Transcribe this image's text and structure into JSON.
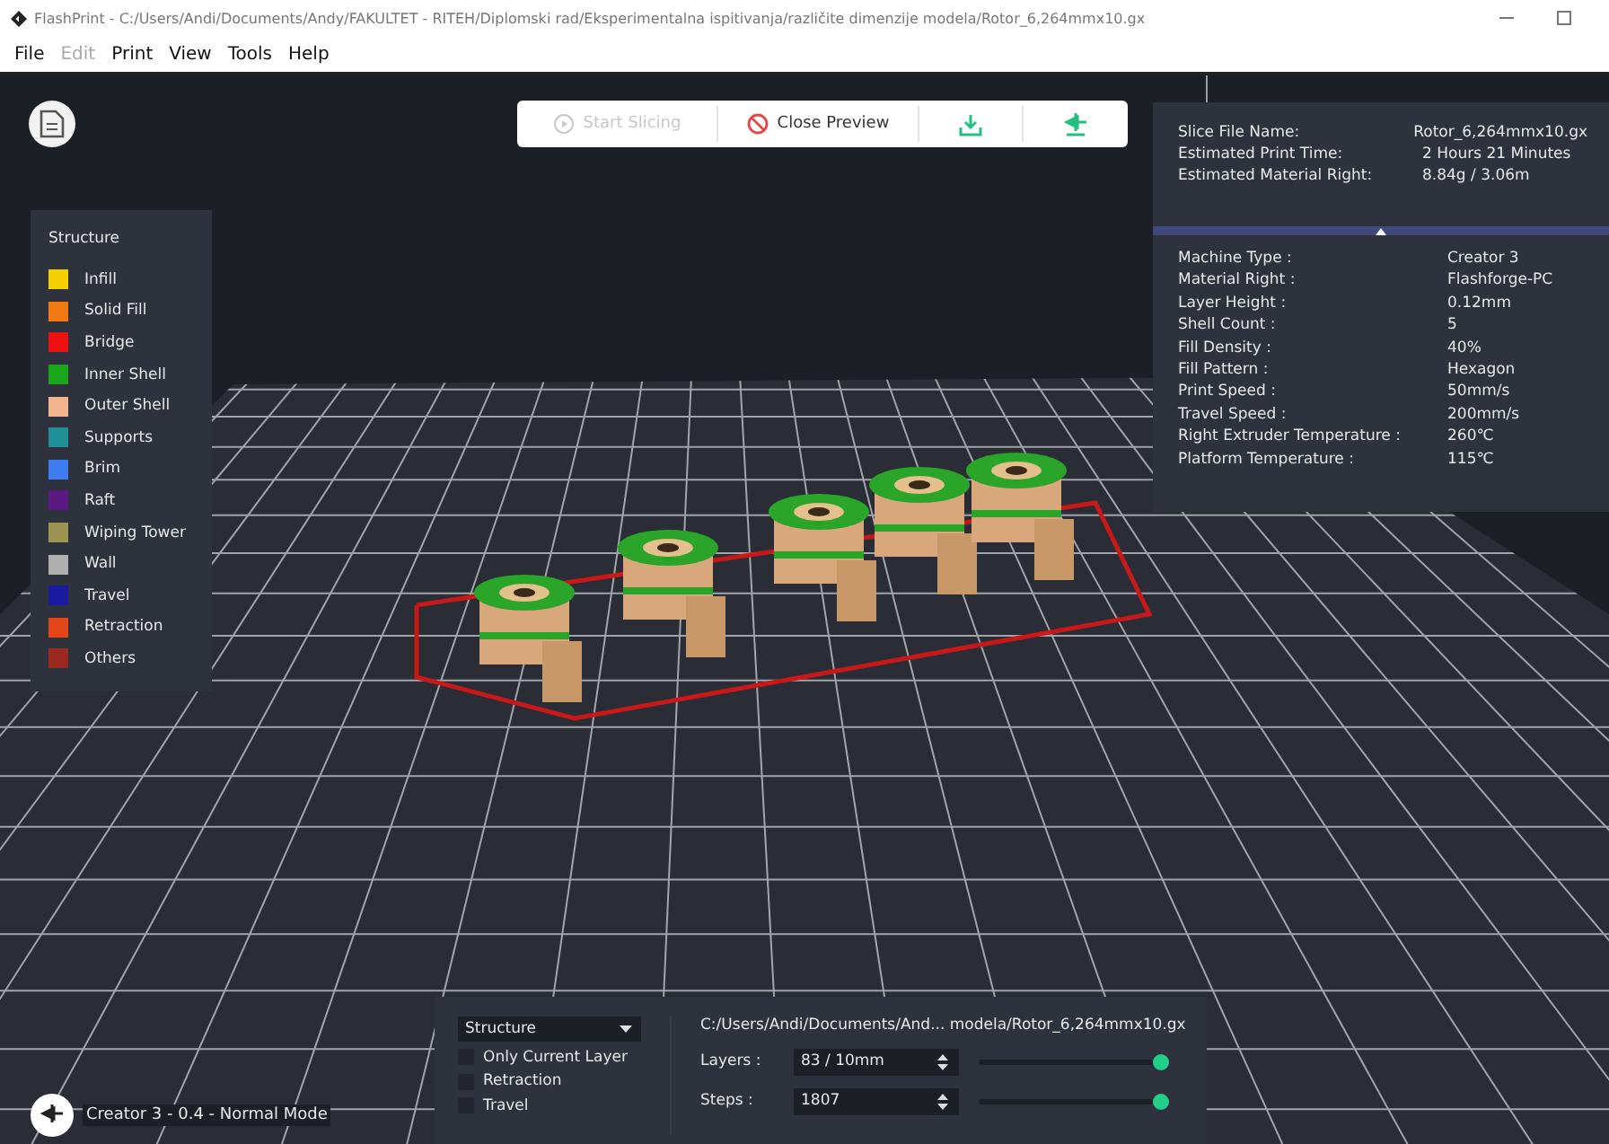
{
  "window": {
    "title": "FlashPrint - C:/Users/Andi/Documents/Andy/FAKULTET - RITEH/Diplomski rad/Eksperimentalna ispitivanja/različite dimenzije modela/Rotor_6,264mmx10.gx"
  },
  "menu": [
    {
      "label": "File",
      "disabled": false
    },
    {
      "label": "Edit",
      "disabled": true
    },
    {
      "label": "Print",
      "disabled": false
    },
    {
      "label": "View",
      "disabled": false
    },
    {
      "label": "Tools",
      "disabled": false
    },
    {
      "label": "Help",
      "disabled": false
    }
  ],
  "toolbar": [
    {
      "kind": "start",
      "label": "Start Slicing",
      "disabled": true
    },
    {
      "kind": "close",
      "label": "Close Preview",
      "disabled": false
    },
    {
      "kind": "export"
    },
    {
      "kind": "print"
    }
  ],
  "slice_info": [
    {
      "label": "Slice File Name:",
      "value": "Rotor_6,264mmx10.gx"
    },
    {
      "label": "Estimated Print Time:",
      "value": "2 Hours 21 Minutes"
    },
    {
      "label": "Estimated Material Right:",
      "value": "8.84g / 3.06m"
    }
  ],
  "machine_info": [
    {
      "label": "Machine Type :",
      "value": "Creator 3"
    },
    {
      "label": "Material Right :",
      "value": "Flashforge-PC"
    },
    {
      "label": "Layer Height :",
      "value": "0.12mm"
    },
    {
      "label": "Shell Count :",
      "value": "5"
    },
    {
      "label": "Fill Density :",
      "value": "40%"
    },
    {
      "label": "Fill Pattern :",
      "value": "Hexagon"
    },
    {
      "label": "Print Speed :",
      "value": "50mm/s"
    },
    {
      "label": "Travel Speed :",
      "value": "200mm/s"
    },
    {
      "label": "Right Extruder Temperature :",
      "value": "260℃"
    },
    {
      "label": "Platform Temperature :",
      "value": "115℃"
    }
  ],
  "legend": {
    "title": "Structure",
    "items": [
      {
        "label": "Infill",
        "color": "#f5d000"
      },
      {
        "label": "Solid Fill",
        "color": "#f07a10"
      },
      {
        "label": "Bridge",
        "color": "#ee1010"
      },
      {
        "label": "Inner Shell",
        "color": "#1aa51a"
      },
      {
        "label": "Outer Shell",
        "color": "#f2b48c"
      },
      {
        "label": "Supports",
        "color": "#1f8f95"
      },
      {
        "label": "Brim",
        "color": "#3f7cf0"
      },
      {
        "label": "Raft",
        "color": "#5a1a82"
      },
      {
        "label": "Wiping Tower",
        "color": "#9a9450"
      },
      {
        "label": "Wall",
        "color": "#b0b0b0"
      },
      {
        "label": "Travel",
        "color": "#1a1aa0"
      },
      {
        "label": "Retraction",
        "color": "#e2461a"
      },
      {
        "label": "Others",
        "color": "#9a2a20"
      }
    ]
  },
  "preview_panel": {
    "mode": "Structure",
    "options": [
      {
        "label": "Only Current Layer",
        "checked": false
      },
      {
        "label": "Retraction",
        "checked": false
      },
      {
        "label": "Travel",
        "checked": false
      }
    ],
    "file_path": "C:/Users/Andi/Documents/And... modela/Rotor_6,264mmx10.gx",
    "sliders": [
      {
        "label": "Layers :",
        "value": "83 / 10mm",
        "level": 1
      },
      {
        "label": "Steps :",
        "value": "1807",
        "level": 1
      }
    ]
  },
  "status": "Creator 3 - 0.4 - Normal Mode"
}
